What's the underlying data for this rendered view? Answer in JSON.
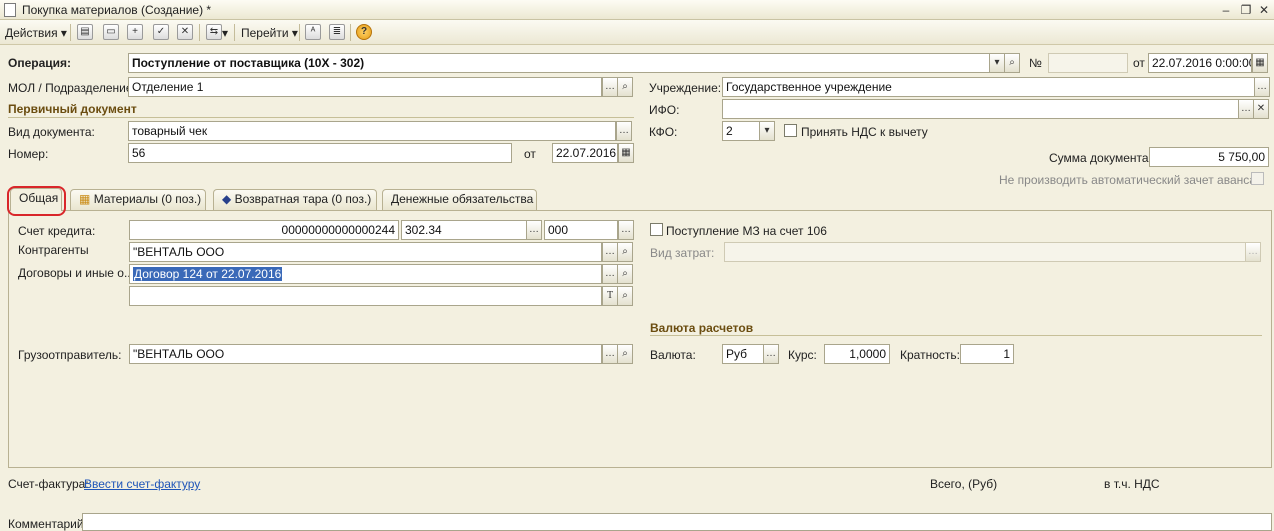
{
  "window": {
    "title": "Покупка материалов (Создание) *",
    "controls": [
      "–",
      "❐",
      "✕"
    ]
  },
  "toolbar": {
    "actions_label": "Действия",
    "goto_label": "Перейти",
    "icons": [
      "new-icon",
      "copy-icon",
      "add-icon",
      "post-icon",
      "delete-icon",
      "structure-icon",
      "dt-kt-icon",
      "journal-icon",
      "help-icon"
    ]
  },
  "header": {
    "operation_label": "Операция:",
    "operation_value": "Поступление от поставщика (10Х - 302)",
    "number_label": "№",
    "number_value": "",
    "date_label": "от",
    "date_value": "22.07.2016  0:00:00",
    "mol_label": "МОЛ / Подразделение:",
    "mol_value": "Отделение 1",
    "institution_label": "Учреждение:",
    "institution_value": "Государственное учреждение",
    "primary_doc_section": "Первичный документ",
    "ifo_label": "ИФО:",
    "ifo_value": "",
    "doc_type_label": "Вид документа:",
    "doc_type_value": "товарный чек",
    "kfo_label": "КФО:",
    "kfo_value": "2",
    "vat_deduct_label": "Принять НДС к вычету",
    "doc_number_label": "Номер:",
    "doc_number_value": "56",
    "doc_date_label": "от",
    "doc_date_value": "22.07.2016",
    "doc_sum_label": "Сумма документа:",
    "doc_sum_value": "5 750,00",
    "no_auto_offset_label": "Не производить автоматический зачет аванса"
  },
  "tabs": [
    {
      "label": "Общая"
    },
    {
      "label": "Материалы (0 поз.)"
    },
    {
      "label": "Возвратная тара (0 поз.)"
    },
    {
      "label": "Денежные обязательства"
    }
  ],
  "general_tab": {
    "credit_account_label": "Счет кредита:",
    "credit_account_code": "00000000000000244",
    "credit_account_num": "302.34",
    "credit_account_kosgu": "000",
    "contractors_label": "Контрагенты",
    "contractor_value": "\"ВЕНТАЛЬ ООО",
    "contracts_label": "Договоры и иные о...",
    "contract_value": "Договор 124 от 22.07.2016",
    "contract_extra_value": "",
    "shipper_label": "Грузоотправитель:",
    "shipper_value": "\"ВЕНТАЛЬ ООО",
    "mz_106_label": "Поступление МЗ на счет 106",
    "cost_type_label": "Вид затрат:",
    "cost_type_value": "",
    "currency_section": "Валюта расчетов",
    "currency_label": "Валюта:",
    "currency_value": "Руб",
    "rate_label": "Курс:",
    "rate_value": "1,0000",
    "multiplicity_label": "Кратность:",
    "multiplicity_value": "1"
  },
  "footer": {
    "invoice_label": "Счет-фактура:",
    "invoice_link": "Ввести счет-фактуру",
    "total_label": "Всего, (Руб)",
    "vat_label": "в т.ч. НДС",
    "comment_label": "Комментарий:",
    "comment_value": ""
  },
  "colors": {
    "background": "#f3f0e0",
    "section_title": "#6b4d10",
    "highlight_circle": "#d9262a",
    "selection": "#3a69b8",
    "link": "#1f55b8"
  }
}
